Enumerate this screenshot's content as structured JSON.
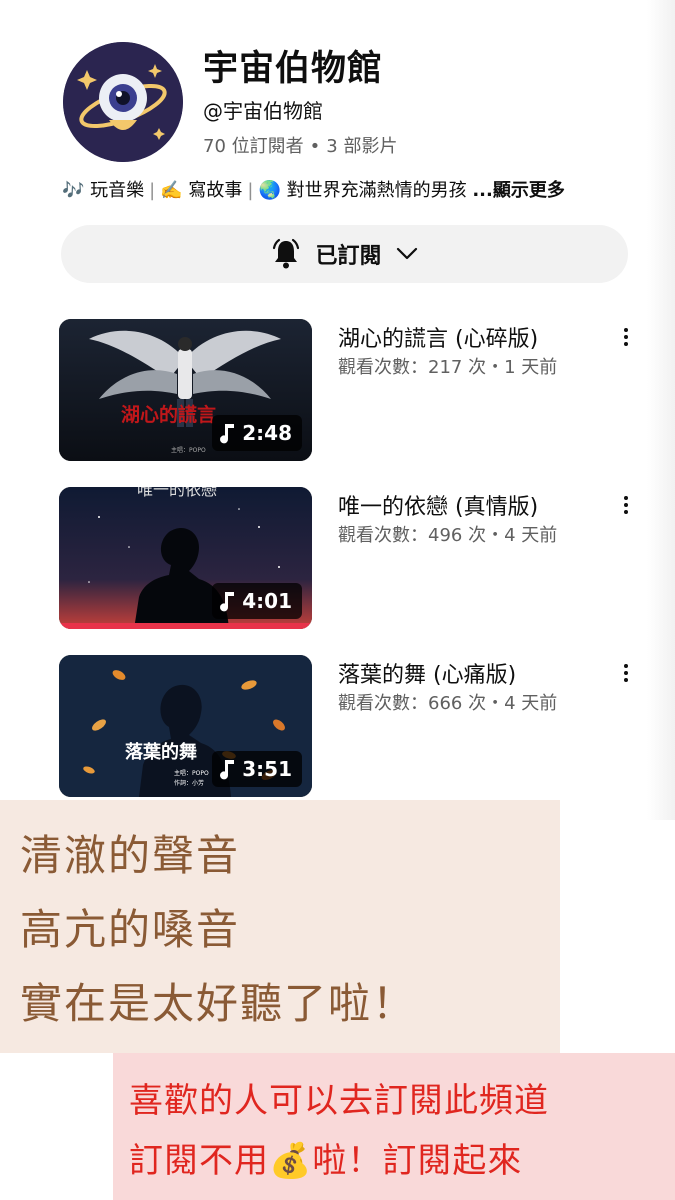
{
  "channel": {
    "name": "宇宙伯物館",
    "handle": "@宇宙伯物館",
    "subscribers": "70 位訂閱者",
    "videos_count": "3 部影片",
    "dot": "•",
    "description": {
      "items": [
        "🎶 玩音樂",
        "✍️ 寫故事",
        "🌏 對世界充滿熱情的男孩"
      ],
      "separator": "|",
      "more": "...顯示更多"
    },
    "avatar_icon": "planet-eye-logo"
  },
  "subscribe": {
    "label": "已訂閱",
    "bell_icon": "bell-icon",
    "chevron_icon": "chevron-down-icon"
  },
  "videos": [
    {
      "title": "湖心的謊言 (心碎版)",
      "meta": "觀看次數：217 次・1 天前",
      "duration": "2:48"
    },
    {
      "title": "唯一的依戀 (真情版)",
      "meta": "觀看次數：496 次・4 天前",
      "duration": "4:01"
    },
    {
      "title": "落葉的舞 (心痛版)",
      "meta": "觀看次數：666 次・4 天前",
      "duration": "3:51"
    }
  ],
  "thumbnail_text": {
    "t1": "湖心的謊言",
    "t1_small": "主唱：POPO",
    "t2": "唯一的依戀",
    "t3": "落葉的舞",
    "t3_small1": "主唱：POPO",
    "t3_small2": "作詞：小芳"
  },
  "overlay_note": {
    "lines": [
      "清澈的聲音",
      "高亢的嗓音",
      "實在是太好聽了啦！"
    ]
  },
  "overlay_cta": {
    "lines": [
      "喜歡的人可以去訂閱此頻道",
      "訂閱不用💰啦！訂閱起來"
    ]
  },
  "colors": {
    "note_bg": "#f6e9e1",
    "note_text": "#8a5a35",
    "cta_bg": "#f9d9d9",
    "cta_text": "#e0261f"
  }
}
